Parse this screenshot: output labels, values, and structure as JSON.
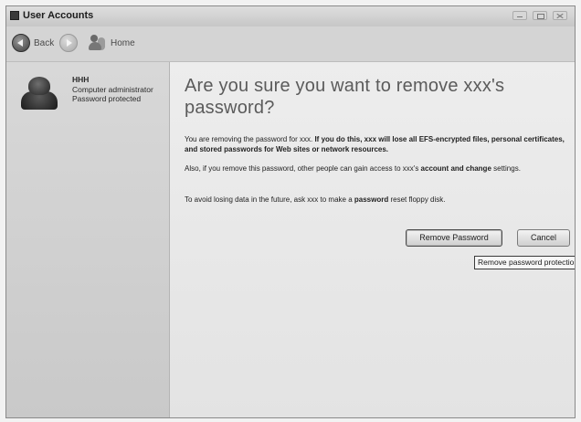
{
  "window": {
    "title": "User Accounts"
  },
  "toolbar": {
    "back_label": "Back",
    "home_label": "Home"
  },
  "account": {
    "name": "HHH",
    "type": "Computer administrator",
    "status": "Password protected"
  },
  "dialog": {
    "heading": "Are you sure you want to remove xxx's password?",
    "warning_plain": "You are removing the password for xxx. ",
    "warning_bold": "If you do this, xxx will lose all EFS-encrypted files, personal certificates, and stored passwords for Web sites or network resources.",
    "access_plain": "Also, if you remove this password, other people can gain access to xxx's ",
    "access_bold": "account and change",
    "access_end": " settings.",
    "reset_plain": "To avoid losing data in the future, ask xxx to make a ",
    "reset_bold": "password",
    "reset_end": " reset floppy disk.",
    "remove_button": "Remove Password",
    "cancel_button": "Cancel",
    "tooltip": "Remove password protection"
  }
}
